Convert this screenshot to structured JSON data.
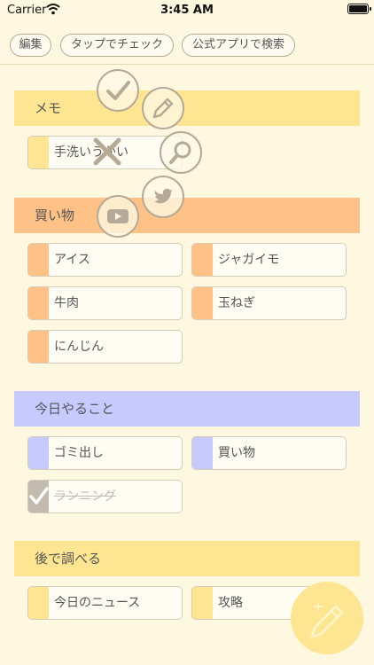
{
  "status_bar": {
    "carrier": "Carrier",
    "time": "3:45 AM"
  },
  "toolbar": {
    "buttons": [
      "編集",
      "タップでチェック",
      "公式アプリで検索"
    ]
  },
  "colors": {
    "memo": "#fde592",
    "shopping": "#ffc186",
    "today": "#c6caff",
    "later": "#fde592",
    "background": "#fff8e1"
  },
  "sections": [
    {
      "title": "メモ",
      "items": [
        {
          "label": "手洗いうがい"
        }
      ]
    },
    {
      "title": "買い物",
      "items": [
        {
          "label": "アイス"
        },
        {
          "label": "ジャガイモ"
        },
        {
          "label": "牛肉"
        },
        {
          "label": "玉ねぎ"
        },
        {
          "label": "にんじん"
        }
      ]
    },
    {
      "title": "今日やること",
      "items": [
        {
          "label": "ゴミ出し"
        },
        {
          "label": "買い物"
        },
        {
          "label": "ランニング",
          "checked": true
        }
      ]
    },
    {
      "title": "後で調べる",
      "items": [
        {
          "label": "今日のニュース"
        },
        {
          "label": "攻略"
        }
      ]
    }
  ],
  "action_icons": [
    "check-icon",
    "pencil-icon",
    "close-icon",
    "search-icon",
    "twitter-icon",
    "youtube-icon"
  ],
  "fab": {
    "icon": "pencil-plus-icon"
  }
}
